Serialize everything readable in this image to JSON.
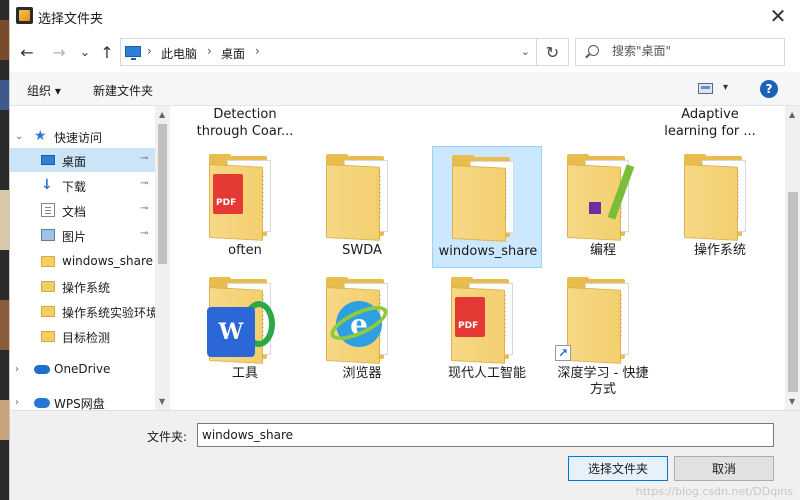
{
  "window": {
    "title": "选择文件夹",
    "close_glyph": "✕",
    "app_icon": "app-folder-icon"
  },
  "nav": {
    "back_glyph": "←",
    "forward_glyph": "→",
    "recent_glyph": "⌄",
    "up_glyph": "↑",
    "address": {
      "segments": [
        "此电脑",
        "桌面"
      ],
      "separator_glyph": "›",
      "dropdown_glyph": "⌄"
    },
    "refresh_glyph": "↻",
    "search": {
      "placeholder": "搜索\"桌面\""
    }
  },
  "toolbar": {
    "organize_label": "组织 ▾",
    "new_folder_label": "新建文件夹",
    "view_dropdown_glyph": "▾",
    "help_glyph": "?"
  },
  "sidebar": {
    "items": [
      {
        "label": "快速访问",
        "icon": "star-icon",
        "chevron": "⌄",
        "pinned": false,
        "selected": false
      },
      {
        "label": "桌面",
        "icon": "desktop-icon",
        "chevron": "",
        "pinned": true,
        "selected": true
      },
      {
        "label": "下载",
        "icon": "download-icon",
        "chevron": "",
        "pinned": true,
        "selected": false
      },
      {
        "label": "文档",
        "icon": "document-icon",
        "chevron": "",
        "pinned": true,
        "selected": false
      },
      {
        "label": "图片",
        "icon": "picture-icon",
        "chevron": "",
        "pinned": true,
        "selected": false
      },
      {
        "label": "windows_share",
        "icon": "folder-icon",
        "chevron": "",
        "pinned": false,
        "selected": false
      },
      {
        "label": "操作系统",
        "icon": "folder-icon",
        "chevron": "",
        "pinned": false,
        "selected": false
      },
      {
        "label": "操作系统实验环境",
        "icon": "folder-icon",
        "chevron": "",
        "pinned": false,
        "selected": false
      },
      {
        "label": "目标检测",
        "icon": "folder-icon",
        "chevron": "",
        "pinned": false,
        "selected": false
      },
      {
        "label": "OneDrive",
        "icon": "onedrive-icon",
        "chevron": "›",
        "pinned": false,
        "selected": false
      },
      {
        "label": "WPS网盘",
        "icon": "wps-cloud-icon",
        "chevron": "›",
        "pinned": false,
        "selected": false
      }
    ],
    "pin_glyph": "📌"
  },
  "content": {
    "top_partial": [
      {
        "label": "Detection\nthrough Coar..."
      },
      {
        "label": "Adaptive\nlearning for ..."
      }
    ],
    "tiles": [
      {
        "label": "often",
        "badge": "pdf",
        "selected": false
      },
      {
        "label": "SWDA",
        "badge": "plain",
        "selected": false
      },
      {
        "label": "windows_share",
        "badge": "plain",
        "selected": true
      },
      {
        "label": "编程",
        "badge": "pencil",
        "selected": false
      },
      {
        "label": "操作系统",
        "badge": "plain",
        "selected": false
      },
      {
        "label": "工具",
        "badge": "wps",
        "selected": false
      },
      {
        "label": "浏览器",
        "badge": "ie",
        "selected": false
      },
      {
        "label": "现代人工智能",
        "badge": "pdf",
        "selected": false
      },
      {
        "label": "深度学习 - 快捷方式",
        "badge": "shortcut",
        "selected": false
      }
    ]
  },
  "footer": {
    "folder_label": "文件夹:",
    "folder_value": "windows_share",
    "select_button": "选择文件夹",
    "cancel_button": "取消",
    "watermark": "https://blog.csdn.net/DDqins"
  }
}
